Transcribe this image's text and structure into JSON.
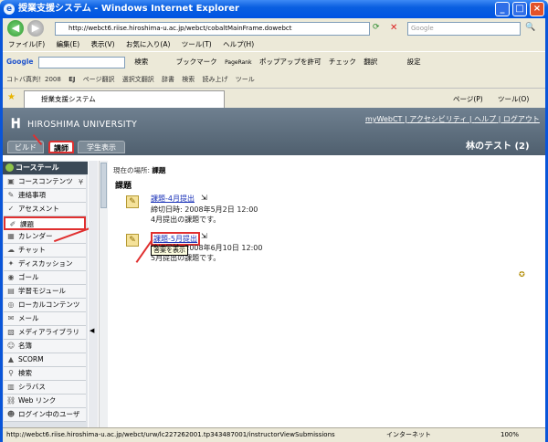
{
  "window": {
    "title": "授業支援システム - Windows Internet Explorer",
    "address": "http://webct6.riise.hiroshima-u.ac.jp/webct/cobaltMainFrame.dowebct",
    "search_placeholder": "Google"
  },
  "menu": [
    "ファイル(F)",
    "編集(E)",
    "表示(V)",
    "お気に入り(A)",
    "ツール(T)",
    "ヘルプ(H)"
  ],
  "google_toolbar": {
    "items": [
      "検索",
      "ブックマーク",
      "PageRank",
      "ポップアップを許可",
      "チェック",
      "翻訳",
      "設定"
    ]
  },
  "bookmark_bar": {
    "items": [
      "コトバ真判！2008",
      "EJ",
      "ページ翻訳",
      "選択文翻訳",
      "辞書",
      "検索",
      "読み上げ",
      "ツール"
    ]
  },
  "tab": {
    "label": "授業支援システム"
  },
  "tab_tools": [
    "ページ(P)",
    "ツール(O)"
  ],
  "webct": {
    "university": "HIROSHIMA UNIVERSITY",
    "top_links": [
      "myWebCT",
      "アクセシビリティ",
      "ヘルプ",
      "ログアウト"
    ],
    "course_title": "林のテスト (2)",
    "role_tabs": [
      "ビルド",
      "講師",
      "学生表示"
    ]
  },
  "sidebar": {
    "header": "コーステール",
    "items": [
      {
        "label": "コースコンテンツ",
        "icon": "folder-icon"
      },
      {
        "label": "連絡事項",
        "icon": "notice-icon"
      },
      {
        "label": "アセスメント",
        "icon": "assessment-icon"
      },
      {
        "label": "課題",
        "icon": "assignment-icon"
      },
      {
        "label": "カレンダー",
        "icon": "calendar-icon"
      },
      {
        "label": "チャット",
        "icon": "chat-icon"
      },
      {
        "label": "ディスカッション",
        "icon": "discussion-icon"
      },
      {
        "label": "ゴール",
        "icon": "goal-icon"
      },
      {
        "label": "学習モジュール",
        "icon": "module-icon"
      },
      {
        "label": "ローカルコンテンツ",
        "icon": "local-icon"
      },
      {
        "label": "メール",
        "icon": "mail-icon"
      },
      {
        "label": "メディアライブラリ",
        "icon": "media-icon"
      },
      {
        "label": "名簿",
        "icon": "roster-icon"
      },
      {
        "label": "SCORM",
        "icon": "scorm-icon"
      },
      {
        "label": "検索",
        "icon": "search-icon"
      },
      {
        "label": "シラバス",
        "icon": "syllabus-icon"
      },
      {
        "label": "Web リンク",
        "icon": "weblink-icon"
      },
      {
        "label": "ログイン中のユーザ",
        "icon": "users-icon"
      }
    ]
  },
  "content": {
    "breadcrumb_label": "現在の場所:",
    "breadcrumb_value": "課題",
    "heading": "課題",
    "assignments": [
      {
        "title": "課題-4月提出",
        "due": "締切日時: 2008年5月2日 12:00",
        "desc": "4月提出の課題です。"
      },
      {
        "title": "課題-5月提出",
        "due": "締切日時: 2008年6月10日 12:00",
        "desc": "5月提出の課題です。"
      }
    ],
    "tooltip": "答案を表示"
  },
  "status": {
    "url": "http://webct6.riise.hiroshima-u.ac.jp/webct/urw/lc227262001.tp343487001/instructorViewSubmissions",
    "zone": "インターネット",
    "zoom": "100%"
  }
}
